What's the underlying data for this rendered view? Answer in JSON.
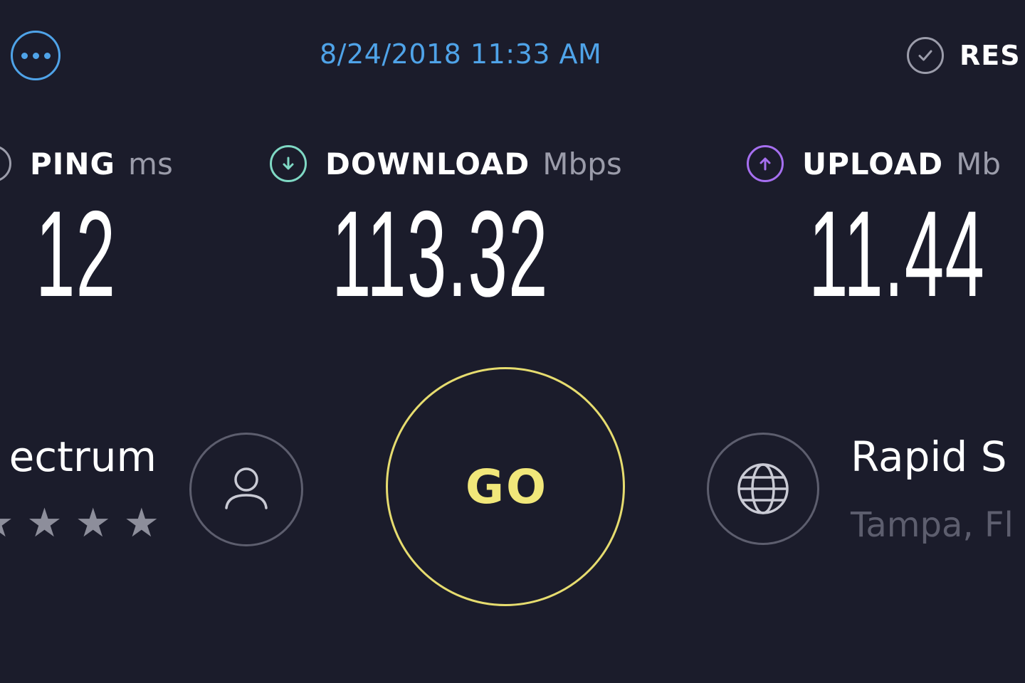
{
  "header": {
    "more_icon": "more-dots-icon",
    "timestamp": "8/24/2018 11:33 AM",
    "results_icon": "check-circle-icon",
    "results_label": "RES"
  },
  "metrics": {
    "ping": {
      "icon": "ping-icon",
      "name": "PING",
      "unit": "ms",
      "value": "12",
      "color": "#9b9caa"
    },
    "download": {
      "icon": "download-arrow-icon",
      "name": "DOWNLOAD",
      "unit": "Mbps",
      "value": "113.32",
      "color": "#7fd8c4"
    },
    "upload": {
      "icon": "upload-arrow-icon",
      "name": "UPLOAD",
      "unit": "Mb",
      "value": "11.44",
      "color": "#a66ff0"
    }
  },
  "provider": {
    "name": "ectrum",
    "rating_stars_visible": 4,
    "icon": "user-icon"
  },
  "go_button": {
    "label": "GO",
    "color": "#f1e77a"
  },
  "server": {
    "icon": "globe-icon",
    "name": "Rapid S",
    "location": "Tampa, Fl"
  },
  "colors": {
    "background": "#1b1c2b",
    "accent_blue": "#4fa3e8",
    "go_yellow": "#e6dc6f"
  }
}
